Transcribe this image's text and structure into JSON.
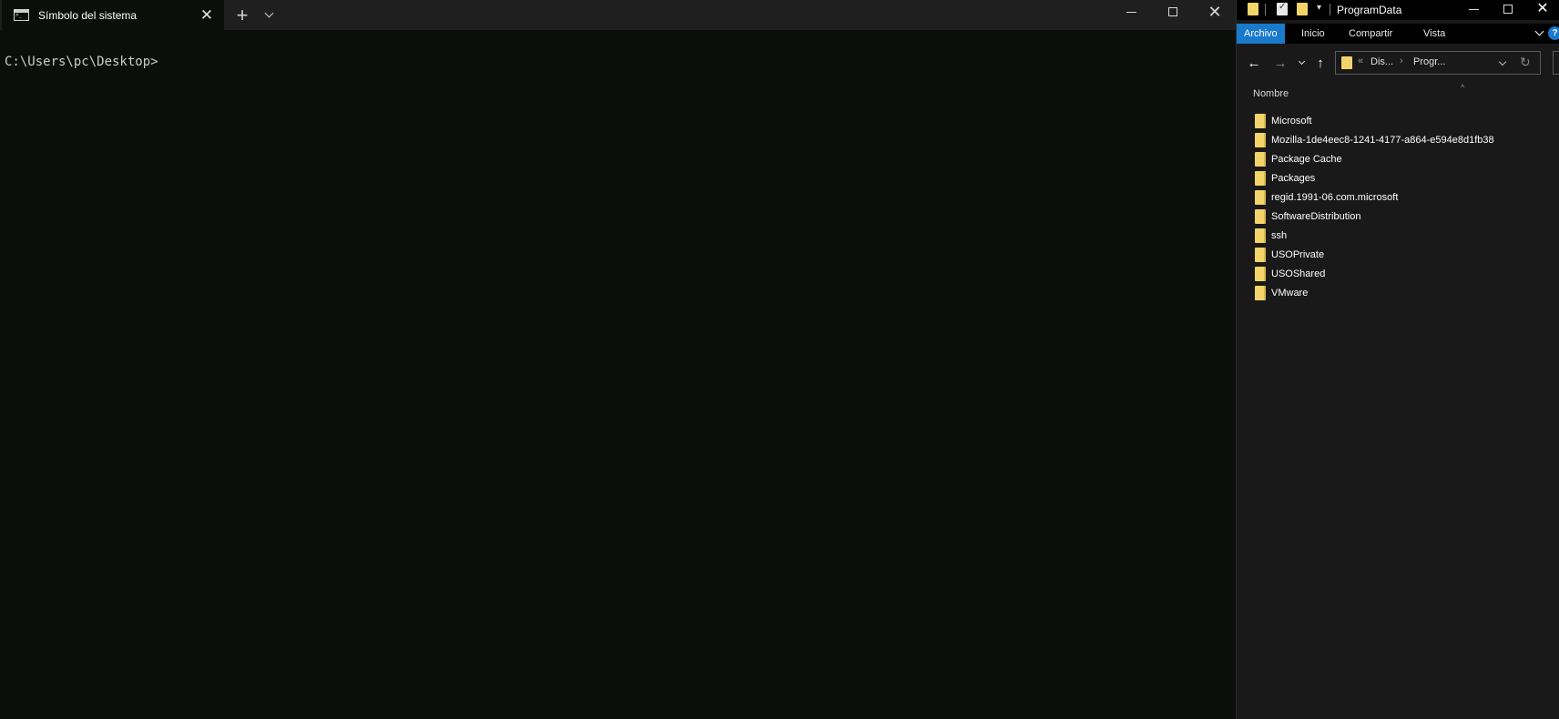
{
  "terminal": {
    "tab_title": "Símbolo del sistema",
    "prompt": "C:\\Users\\pc\\Desktop>"
  },
  "explorer": {
    "title": "ProgramData",
    "ribbon_tabs": [
      "Archivo",
      "Inicio",
      "Compartir",
      "Vista"
    ],
    "help_label": "?",
    "address_crumbs": [
      "Dis...",
      "Progr..."
    ],
    "address_prefix": "«",
    "column_header": "Nombre",
    "items": [
      "Microsoft",
      "Mozilla-1de4eec8-1241-4177-a864-e594e8d1fb38",
      "Package Cache",
      "Packages",
      "regid.1991-06.com.microsoft",
      "SoftwareDistribution",
      "ssh",
      "USOPrivate",
      "USOShared",
      "VMware"
    ]
  },
  "colors": {
    "terminal_bg": "#0b0f0a",
    "explorer_bg": "#191919",
    "accent": "#1979ca",
    "folder": "#f2d46b"
  },
  "icons": {
    "terminal_tab": "cmd-icon",
    "folder": "folder-icon",
    "back": "back-arrow-icon",
    "forward": "forward-arrow-icon",
    "up": "up-arrow-icon",
    "refresh": "refresh-icon"
  }
}
